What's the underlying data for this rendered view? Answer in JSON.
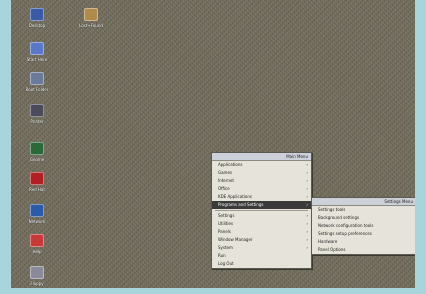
{
  "desktop_icons": [
    {
      "name": "home-folder-icon",
      "label": "Desktop",
      "color": "#3a5aa8"
    },
    {
      "name": "trash-icon",
      "label": "Lost+Found",
      "color": "#b08a4a"
    },
    {
      "name": "monitor-icon",
      "label": "Start Here",
      "color": "#5a78c8"
    },
    {
      "name": "computer-icon",
      "label": "Root Folder",
      "color": "#6a7a9a"
    },
    {
      "name": "printer-icon",
      "label": "Printer",
      "color": "#4a4a5a"
    },
    {
      "name": "terminal-icon",
      "label": "Gnome",
      "color": "#2a6a3a"
    },
    {
      "name": "bug-icon",
      "label": "Red Hat",
      "color": "#b02020"
    },
    {
      "name": "network-icon",
      "label": "Network",
      "color": "#2a5aa8"
    },
    {
      "name": "help-icon",
      "label": "Help",
      "color": "#c83a3a"
    },
    {
      "name": "disk-icon",
      "label": "Floppy",
      "color": "#8a8a9a"
    }
  ],
  "main_menu": {
    "title": "Main Menu",
    "items": [
      "Applications",
      "Games",
      "Internet",
      "Office",
      "KDE Applications",
      "Programs and Settings"
    ],
    "items2": [
      "Settings",
      "Utilities",
      "Panels",
      "Window Manager",
      "System",
      "Run",
      "Log Out"
    ]
  },
  "sub_menu": {
    "title": "Settings Menu",
    "items": [
      "Settings tools",
      "Background settings",
      "Network configuration tools",
      "Settings setup preferences",
      "Hardware",
      "Panel Options"
    ]
  }
}
